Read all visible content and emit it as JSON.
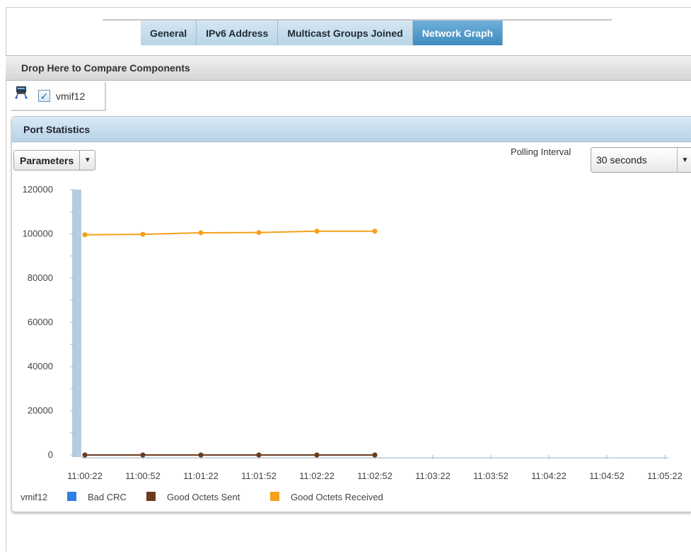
{
  "tabs": [
    {
      "label": "General",
      "active": false
    },
    {
      "label": "IPv6 Address",
      "active": false
    },
    {
      "label": "Multicast Groups Joined",
      "active": false
    },
    {
      "label": "Network Graph",
      "active": true
    }
  ],
  "drop_zone": {
    "label": "Drop Here to Compare Components"
  },
  "component_chip": {
    "label": "vmif12",
    "checked": true,
    "icon": "network-device-icon"
  },
  "panel": {
    "title": "Port Statistics"
  },
  "parameters": {
    "label": "Parameters"
  },
  "polling": {
    "label": "Polling Interval",
    "value": "30 seconds"
  },
  "colors": {
    "bad_crc": "#2f7fe0",
    "good_octets_sent": "#6b3b1c",
    "good_octets_received": "#f5a01a",
    "axis_band": "#b5cbe0",
    "tab_active": "#3f8bbf"
  },
  "chart_data": {
    "type": "line",
    "ylim": [
      0,
      120000
    ],
    "y_ticks": [
      "0",
      "20000",
      "40000",
      "60000",
      "80000",
      "100000",
      "120000"
    ],
    "x_ticks": [
      "11:00:22",
      "11:00:52",
      "11:01:22",
      "11:01:52",
      "11:02:22",
      "11:02:52",
      "11:03:22",
      "11:03:52",
      "11:04:22",
      "11:04:52",
      "11:05:22"
    ],
    "legend_title": "vmif12",
    "series": [
      {
        "name": "Bad CRC",
        "color": "#2f7fe0",
        "x": [
          "11:00:22",
          "11:00:52",
          "11:01:22",
          "11:01:52",
          "11:02:22",
          "11:02:52"
        ],
        "values": [
          0,
          0,
          0,
          0,
          0,
          0
        ]
      },
      {
        "name": "Good Octets Sent",
        "color": "#6b3b1c",
        "x": [
          "11:00:22",
          "11:00:52",
          "11:01:22",
          "11:01:52",
          "11:02:22",
          "11:02:52"
        ],
        "values": [
          0,
          0,
          0,
          0,
          0,
          0
        ]
      },
      {
        "name": "Good Octets Received",
        "color": "#f5a01a",
        "x": [
          "11:00:22",
          "11:00:52",
          "11:01:22",
          "11:01:52",
          "11:02:22",
          "11:02:52"
        ],
        "values": [
          99600,
          99800,
          100500,
          100600,
          101200,
          101200
        ]
      }
    ]
  }
}
